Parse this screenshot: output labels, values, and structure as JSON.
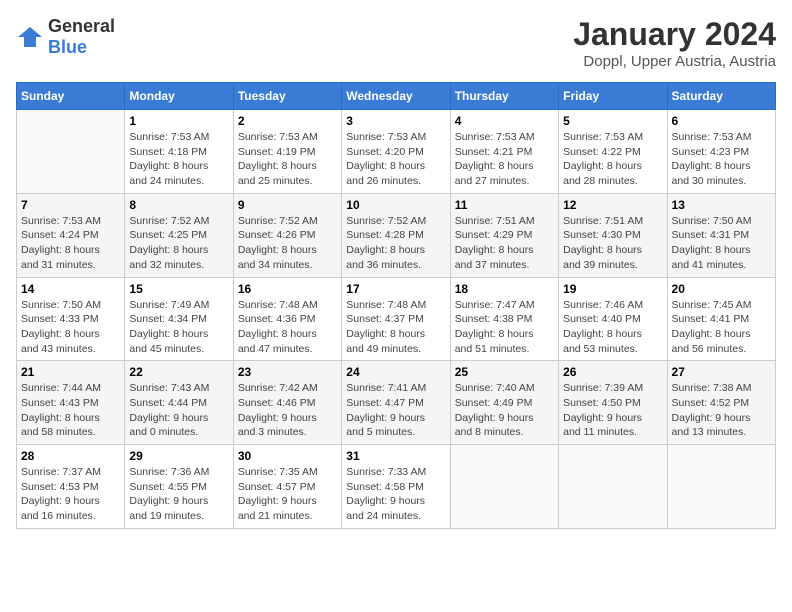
{
  "logo": {
    "general": "General",
    "blue": "Blue"
  },
  "header": {
    "month": "January 2024",
    "location": "Doppl, Upper Austria, Austria"
  },
  "weekdays": [
    "Sunday",
    "Monday",
    "Tuesday",
    "Wednesday",
    "Thursday",
    "Friday",
    "Saturday"
  ],
  "weeks": [
    [
      {
        "day": "",
        "info": ""
      },
      {
        "day": "1",
        "info": "Sunrise: 7:53 AM\nSunset: 4:18 PM\nDaylight: 8 hours\nand 24 minutes."
      },
      {
        "day": "2",
        "info": "Sunrise: 7:53 AM\nSunset: 4:19 PM\nDaylight: 8 hours\nand 25 minutes."
      },
      {
        "day": "3",
        "info": "Sunrise: 7:53 AM\nSunset: 4:20 PM\nDaylight: 8 hours\nand 26 minutes."
      },
      {
        "day": "4",
        "info": "Sunrise: 7:53 AM\nSunset: 4:21 PM\nDaylight: 8 hours\nand 27 minutes."
      },
      {
        "day": "5",
        "info": "Sunrise: 7:53 AM\nSunset: 4:22 PM\nDaylight: 8 hours\nand 28 minutes."
      },
      {
        "day": "6",
        "info": "Sunrise: 7:53 AM\nSunset: 4:23 PM\nDaylight: 8 hours\nand 30 minutes."
      }
    ],
    [
      {
        "day": "7",
        "info": "Sunrise: 7:53 AM\nSunset: 4:24 PM\nDaylight: 8 hours\nand 31 minutes."
      },
      {
        "day": "8",
        "info": "Sunrise: 7:52 AM\nSunset: 4:25 PM\nDaylight: 8 hours\nand 32 minutes."
      },
      {
        "day": "9",
        "info": "Sunrise: 7:52 AM\nSunset: 4:26 PM\nDaylight: 8 hours\nand 34 minutes."
      },
      {
        "day": "10",
        "info": "Sunrise: 7:52 AM\nSunset: 4:28 PM\nDaylight: 8 hours\nand 36 minutes."
      },
      {
        "day": "11",
        "info": "Sunrise: 7:51 AM\nSunset: 4:29 PM\nDaylight: 8 hours\nand 37 minutes."
      },
      {
        "day": "12",
        "info": "Sunrise: 7:51 AM\nSunset: 4:30 PM\nDaylight: 8 hours\nand 39 minutes."
      },
      {
        "day": "13",
        "info": "Sunrise: 7:50 AM\nSunset: 4:31 PM\nDaylight: 8 hours\nand 41 minutes."
      }
    ],
    [
      {
        "day": "14",
        "info": "Sunrise: 7:50 AM\nSunset: 4:33 PM\nDaylight: 8 hours\nand 43 minutes."
      },
      {
        "day": "15",
        "info": "Sunrise: 7:49 AM\nSunset: 4:34 PM\nDaylight: 8 hours\nand 45 minutes."
      },
      {
        "day": "16",
        "info": "Sunrise: 7:48 AM\nSunset: 4:36 PM\nDaylight: 8 hours\nand 47 minutes."
      },
      {
        "day": "17",
        "info": "Sunrise: 7:48 AM\nSunset: 4:37 PM\nDaylight: 8 hours\nand 49 minutes."
      },
      {
        "day": "18",
        "info": "Sunrise: 7:47 AM\nSunset: 4:38 PM\nDaylight: 8 hours\nand 51 minutes."
      },
      {
        "day": "19",
        "info": "Sunrise: 7:46 AM\nSunset: 4:40 PM\nDaylight: 8 hours\nand 53 minutes."
      },
      {
        "day": "20",
        "info": "Sunrise: 7:45 AM\nSunset: 4:41 PM\nDaylight: 8 hours\nand 56 minutes."
      }
    ],
    [
      {
        "day": "21",
        "info": "Sunrise: 7:44 AM\nSunset: 4:43 PM\nDaylight: 8 hours\nand 58 minutes."
      },
      {
        "day": "22",
        "info": "Sunrise: 7:43 AM\nSunset: 4:44 PM\nDaylight: 9 hours\nand 0 minutes."
      },
      {
        "day": "23",
        "info": "Sunrise: 7:42 AM\nSunset: 4:46 PM\nDaylight: 9 hours\nand 3 minutes."
      },
      {
        "day": "24",
        "info": "Sunrise: 7:41 AM\nSunset: 4:47 PM\nDaylight: 9 hours\nand 5 minutes."
      },
      {
        "day": "25",
        "info": "Sunrise: 7:40 AM\nSunset: 4:49 PM\nDaylight: 9 hours\nand 8 minutes."
      },
      {
        "day": "26",
        "info": "Sunrise: 7:39 AM\nSunset: 4:50 PM\nDaylight: 9 hours\nand 11 minutes."
      },
      {
        "day": "27",
        "info": "Sunrise: 7:38 AM\nSunset: 4:52 PM\nDaylight: 9 hours\nand 13 minutes."
      }
    ],
    [
      {
        "day": "28",
        "info": "Sunrise: 7:37 AM\nSunset: 4:53 PM\nDaylight: 9 hours\nand 16 minutes."
      },
      {
        "day": "29",
        "info": "Sunrise: 7:36 AM\nSunset: 4:55 PM\nDaylight: 9 hours\nand 19 minutes."
      },
      {
        "day": "30",
        "info": "Sunrise: 7:35 AM\nSunset: 4:57 PM\nDaylight: 9 hours\nand 21 minutes."
      },
      {
        "day": "31",
        "info": "Sunrise: 7:33 AM\nSunset: 4:58 PM\nDaylight: 9 hours\nand 24 minutes."
      },
      {
        "day": "",
        "info": ""
      },
      {
        "day": "",
        "info": ""
      },
      {
        "day": "",
        "info": ""
      }
    ]
  ]
}
